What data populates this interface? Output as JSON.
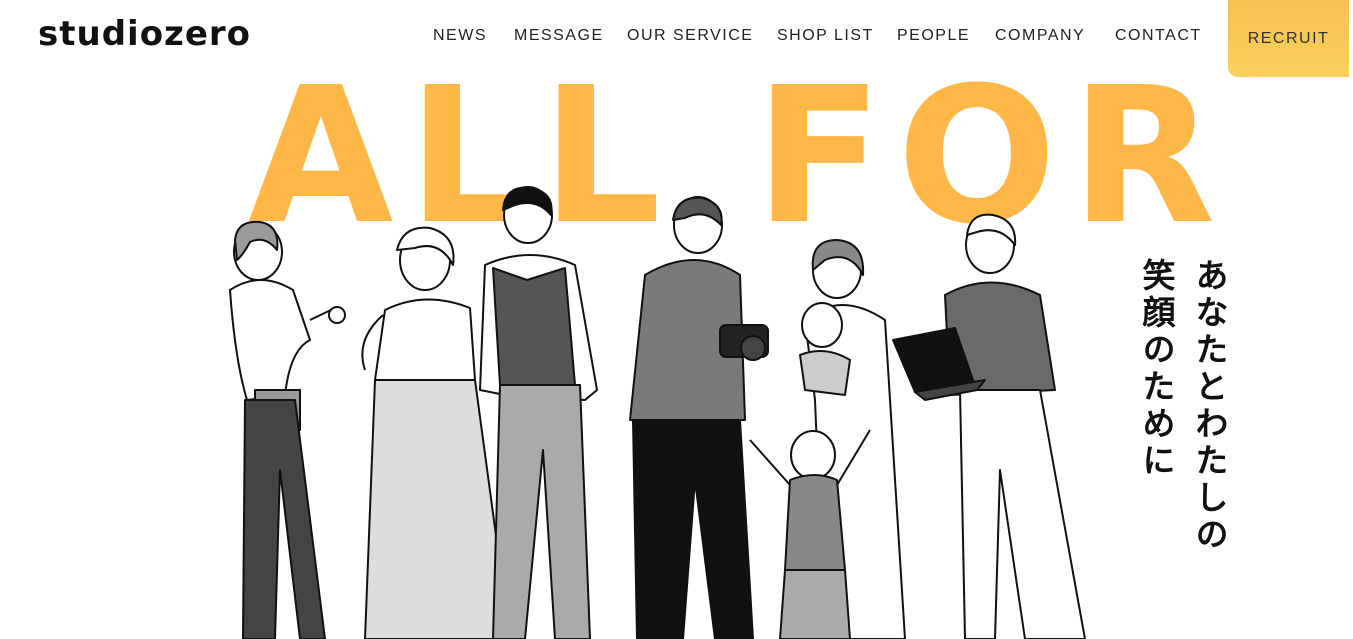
{
  "header": {
    "logo": "studiozero",
    "nav": [
      "NEWS",
      "MESSAGE",
      "OUR SERVICE",
      "SHOP LIST",
      "PEOPLE",
      "COMPANY",
      "CONTACT"
    ],
    "recruit": "RECRUIT"
  },
  "hero": {
    "title": "ALL FOR",
    "tagline_line1": "あなたとわたしの",
    "tagline_line2": "笑顔のために"
  },
  "colors": {
    "accent": "#ffb847",
    "recruit_bg": "#f7c251"
  }
}
